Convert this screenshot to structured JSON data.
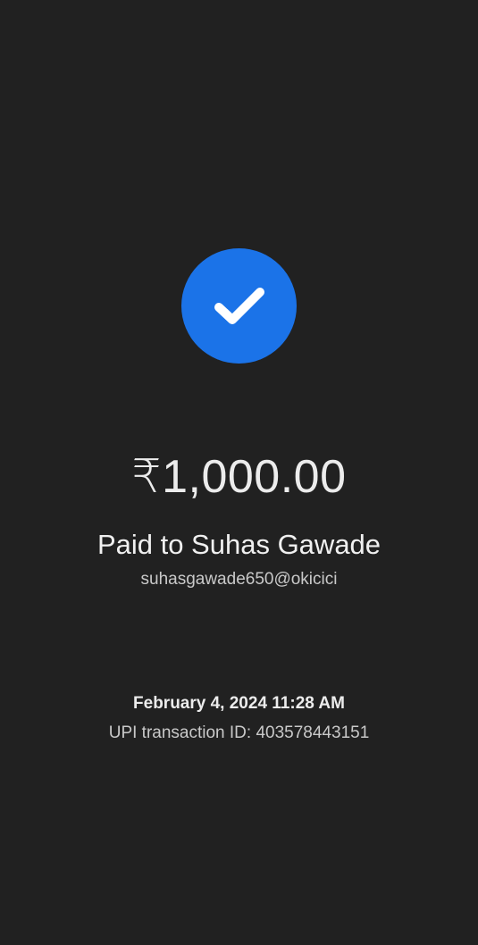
{
  "payment": {
    "status_icon": "check-icon",
    "accent_color": "#1b73e8",
    "amount": "₹1,000.00",
    "paid_to": "Paid to Suhas Gawade",
    "upi_handle": "suhasgawade650@okicici",
    "datetime": "February 4, 2024 11:28 AM",
    "transaction_id": "UPI transaction ID: 403578443151"
  }
}
